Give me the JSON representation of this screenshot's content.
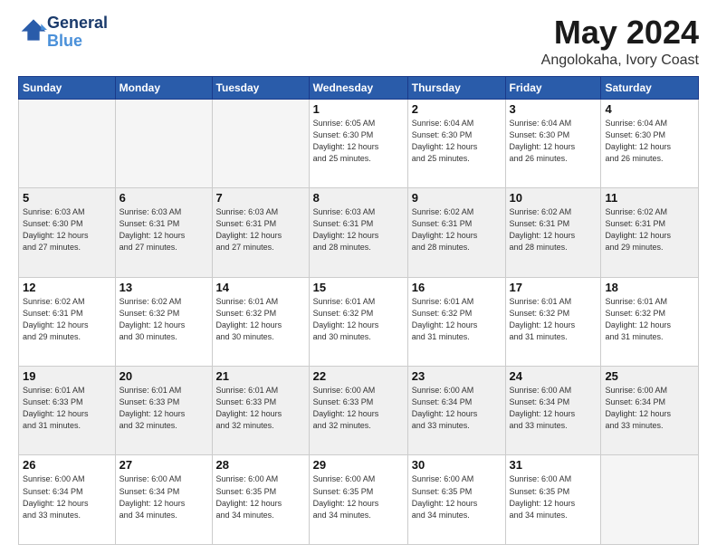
{
  "header": {
    "logo_line1": "General",
    "logo_line2": "Blue",
    "month_year": "May 2024",
    "location": "Angolokaha, Ivory Coast"
  },
  "weekdays": [
    "Sunday",
    "Monday",
    "Tuesday",
    "Wednesday",
    "Thursday",
    "Friday",
    "Saturday"
  ],
  "weeks": [
    [
      {
        "num": "",
        "info": ""
      },
      {
        "num": "",
        "info": ""
      },
      {
        "num": "",
        "info": ""
      },
      {
        "num": "1",
        "info": "Sunrise: 6:05 AM\nSunset: 6:30 PM\nDaylight: 12 hours\nand 25 minutes."
      },
      {
        "num": "2",
        "info": "Sunrise: 6:04 AM\nSunset: 6:30 PM\nDaylight: 12 hours\nand 25 minutes."
      },
      {
        "num": "3",
        "info": "Sunrise: 6:04 AM\nSunset: 6:30 PM\nDaylight: 12 hours\nand 26 minutes."
      },
      {
        "num": "4",
        "info": "Sunrise: 6:04 AM\nSunset: 6:30 PM\nDaylight: 12 hours\nand 26 minutes."
      }
    ],
    [
      {
        "num": "5",
        "info": "Sunrise: 6:03 AM\nSunset: 6:30 PM\nDaylight: 12 hours\nand 27 minutes."
      },
      {
        "num": "6",
        "info": "Sunrise: 6:03 AM\nSunset: 6:31 PM\nDaylight: 12 hours\nand 27 minutes."
      },
      {
        "num": "7",
        "info": "Sunrise: 6:03 AM\nSunset: 6:31 PM\nDaylight: 12 hours\nand 27 minutes."
      },
      {
        "num": "8",
        "info": "Sunrise: 6:03 AM\nSunset: 6:31 PM\nDaylight: 12 hours\nand 28 minutes."
      },
      {
        "num": "9",
        "info": "Sunrise: 6:02 AM\nSunset: 6:31 PM\nDaylight: 12 hours\nand 28 minutes."
      },
      {
        "num": "10",
        "info": "Sunrise: 6:02 AM\nSunset: 6:31 PM\nDaylight: 12 hours\nand 28 minutes."
      },
      {
        "num": "11",
        "info": "Sunrise: 6:02 AM\nSunset: 6:31 PM\nDaylight: 12 hours\nand 29 minutes."
      }
    ],
    [
      {
        "num": "12",
        "info": "Sunrise: 6:02 AM\nSunset: 6:31 PM\nDaylight: 12 hours\nand 29 minutes."
      },
      {
        "num": "13",
        "info": "Sunrise: 6:02 AM\nSunset: 6:32 PM\nDaylight: 12 hours\nand 30 minutes."
      },
      {
        "num": "14",
        "info": "Sunrise: 6:01 AM\nSunset: 6:32 PM\nDaylight: 12 hours\nand 30 minutes."
      },
      {
        "num": "15",
        "info": "Sunrise: 6:01 AM\nSunset: 6:32 PM\nDaylight: 12 hours\nand 30 minutes."
      },
      {
        "num": "16",
        "info": "Sunrise: 6:01 AM\nSunset: 6:32 PM\nDaylight: 12 hours\nand 31 minutes."
      },
      {
        "num": "17",
        "info": "Sunrise: 6:01 AM\nSunset: 6:32 PM\nDaylight: 12 hours\nand 31 minutes."
      },
      {
        "num": "18",
        "info": "Sunrise: 6:01 AM\nSunset: 6:32 PM\nDaylight: 12 hours\nand 31 minutes."
      }
    ],
    [
      {
        "num": "19",
        "info": "Sunrise: 6:01 AM\nSunset: 6:33 PM\nDaylight: 12 hours\nand 31 minutes."
      },
      {
        "num": "20",
        "info": "Sunrise: 6:01 AM\nSunset: 6:33 PM\nDaylight: 12 hours\nand 32 minutes."
      },
      {
        "num": "21",
        "info": "Sunrise: 6:01 AM\nSunset: 6:33 PM\nDaylight: 12 hours\nand 32 minutes."
      },
      {
        "num": "22",
        "info": "Sunrise: 6:00 AM\nSunset: 6:33 PM\nDaylight: 12 hours\nand 32 minutes."
      },
      {
        "num": "23",
        "info": "Sunrise: 6:00 AM\nSunset: 6:34 PM\nDaylight: 12 hours\nand 33 minutes."
      },
      {
        "num": "24",
        "info": "Sunrise: 6:00 AM\nSunset: 6:34 PM\nDaylight: 12 hours\nand 33 minutes."
      },
      {
        "num": "25",
        "info": "Sunrise: 6:00 AM\nSunset: 6:34 PM\nDaylight: 12 hours\nand 33 minutes."
      }
    ],
    [
      {
        "num": "26",
        "info": "Sunrise: 6:00 AM\nSunset: 6:34 PM\nDaylight: 12 hours\nand 33 minutes."
      },
      {
        "num": "27",
        "info": "Sunrise: 6:00 AM\nSunset: 6:34 PM\nDaylight: 12 hours\nand 34 minutes."
      },
      {
        "num": "28",
        "info": "Sunrise: 6:00 AM\nSunset: 6:35 PM\nDaylight: 12 hours\nand 34 minutes."
      },
      {
        "num": "29",
        "info": "Sunrise: 6:00 AM\nSunset: 6:35 PM\nDaylight: 12 hours\nand 34 minutes."
      },
      {
        "num": "30",
        "info": "Sunrise: 6:00 AM\nSunset: 6:35 PM\nDaylight: 12 hours\nand 34 minutes."
      },
      {
        "num": "31",
        "info": "Sunrise: 6:00 AM\nSunset: 6:35 PM\nDaylight: 12 hours\nand 34 minutes."
      },
      {
        "num": "",
        "info": ""
      }
    ]
  ]
}
